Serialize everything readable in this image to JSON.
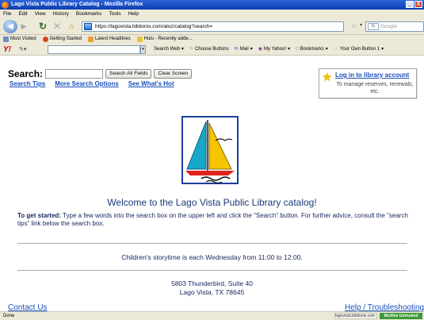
{
  "window": {
    "title": "Lago Vista Public Library Catalog - Mozilla Firefox",
    "minimize": "_",
    "close": "X"
  },
  "menu": [
    "File",
    "Edit",
    "View",
    "History",
    "Bookmarks",
    "Tools",
    "Help"
  ],
  "nav": {
    "url": "https://lagovista.biblionix.com/atoz/catalog?search=",
    "search_placeholder": "Google"
  },
  "bookmarks": [
    {
      "label": "Most Visited",
      "color": "#6b8fc7"
    },
    {
      "label": "Getting Started",
      "color": "#d9431f"
    },
    {
      "label": "Latest Headlines",
      "color": "#e8a23a"
    },
    {
      "label": "Hulu - Recently adde...",
      "color": "#e8c23a"
    }
  ],
  "yahoo_toolbar": {
    "logo": "Y!",
    "items": [
      "Search Web",
      "Choose Buttons",
      "Mail",
      "My Yahoo!",
      "Bookmarks",
      "Your Own Button 1"
    ]
  },
  "page": {
    "search_label": "Search:",
    "search_all_button": "Search All Fields",
    "clear_button": "Clear Screen",
    "links": [
      "Search Tips",
      "More Search Options",
      "See What's Hot"
    ],
    "login": {
      "link": "Log in to library account",
      "desc": "To manage reserves, renewals, etc."
    },
    "welcome": "Welcome to the Lago Vista Public Library catalog!",
    "get_started_label": "To get started:",
    "get_started_text": " Type a few words into the search box on the upper left and click the \"Search\" button. For further advice, consult the \"search tips\" link below the search box.",
    "storytime": "Children's storytime is each Wednesday from 11:00 to 12:00.",
    "address_line1": "5803 Thunderbird, Suite 40",
    "address_line2": "Lago Vista, TX 78645",
    "footer_left": "Contact Us",
    "footer_right": "Help / Troubleshooting"
  },
  "status": {
    "text": "Done",
    "url": "lagovista.biblionix.com",
    "badge": "McAfee Untrusted"
  },
  "colors": {
    "link": "#1a4fba",
    "text": "#1a2a60",
    "chrome": "#ece9d8"
  }
}
